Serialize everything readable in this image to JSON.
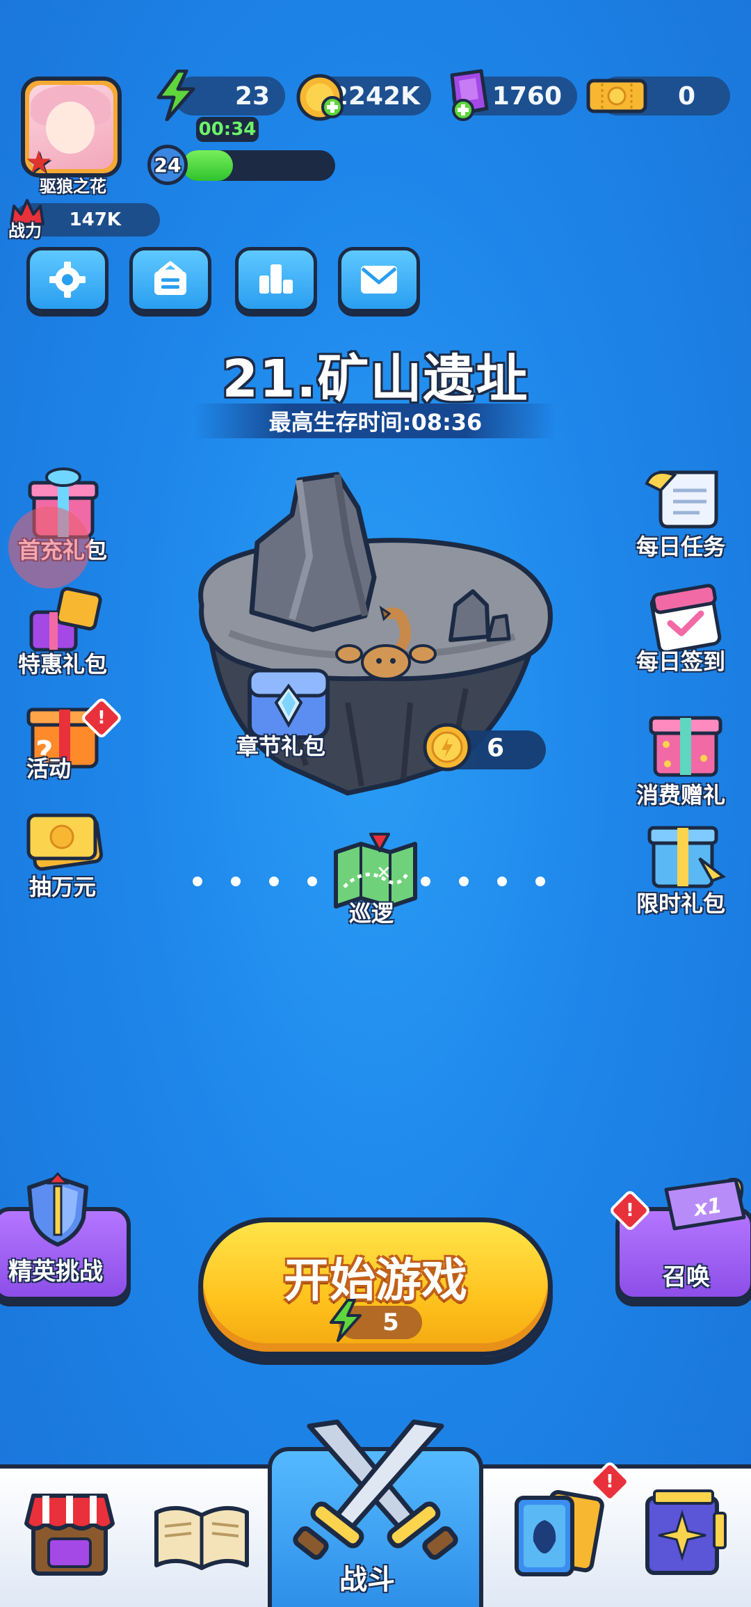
{
  "player": {
    "name": "驱狼之花",
    "level": "24",
    "xp_fraction": 0.33,
    "power_label": "战力",
    "power_value": "147K"
  },
  "resources": {
    "energy": "23",
    "energy_timer": "00:34",
    "coins": "2242K",
    "gems": "1760",
    "tickets": "0"
  },
  "stage": {
    "title": "21.矿山遗址",
    "best_time": "最高生存时间:08:36"
  },
  "island": {
    "chest_label": "章节礼包",
    "coin_count": "6",
    "patrol_label": "巡逻"
  },
  "left_menu": [
    {
      "label": "首充礼包"
    },
    {
      "label": "特惠礼包"
    },
    {
      "label": "活动"
    },
    {
      "label": "抽万元"
    }
  ],
  "right_menu": [
    {
      "label": "每日任务"
    },
    {
      "label": "每日签到"
    },
    {
      "label": "消费赠礼"
    },
    {
      "label": "限时礼包"
    }
  ],
  "buttons": {
    "elite": "精英挑战",
    "start": "开始游戏",
    "start_cost": "5",
    "summon": "召唤",
    "summon_multiplier": "x1"
  },
  "alert": "!",
  "bottom_nav": {
    "battle": "战斗"
  },
  "colors": {
    "background": "#1e86ea",
    "outline": "#1c2a44",
    "start_button": "#ffc21d",
    "purple_button": "#8d4ee8",
    "alert": "#e8313a"
  }
}
